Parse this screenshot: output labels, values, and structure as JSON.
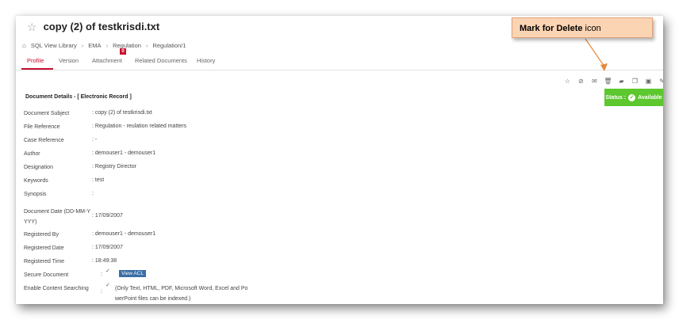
{
  "document": {
    "title": "copy (2) of testkrisdi.txt"
  },
  "breadcrumb": {
    "items": [
      "SQL View Library",
      "EMA",
      "Regulation",
      "Regulation/1"
    ]
  },
  "tabs": [
    {
      "label": "Profile",
      "active": true
    },
    {
      "label": "Version"
    },
    {
      "label": "Attachment",
      "badge": "0"
    },
    {
      "label": "Related Documents"
    },
    {
      "label": "History"
    }
  ],
  "toolbar": {
    "icons": [
      "star-icon",
      "link-icon",
      "mail-icon",
      "trash-icon",
      "folder-icon",
      "copy-icon",
      "lock-icon",
      "edit-icon"
    ]
  },
  "section": {
    "title": "Document Details - [ Electronic Record ]"
  },
  "status": {
    "label": "Status :",
    "value": "Available",
    "color": "#5cc72e"
  },
  "fields": [
    {
      "label": "Document Subject",
      "value": ": copy (2) of testkrisdi.txt"
    },
    {
      "label": "File Reference",
      "value": ": Regulation - reulation related matters"
    },
    {
      "label": "Case Reference",
      "value": ": -"
    },
    {
      "label": "Author",
      "value": ": demouser1 - demouser1"
    },
    {
      "label": "Designation",
      "value": ": Registry Director"
    },
    {
      "label": "Keywords",
      "value": ": test"
    },
    {
      "label": "Synopsis",
      "value": ":"
    },
    {
      "label_line1": "Document Date (DD-MM-Y",
      "label_line2": "YYY)",
      "value": ": 17/09/2007"
    },
    {
      "label": "Registered By",
      "value": ": demouser1 - demouser1"
    },
    {
      "label": "Registered Date",
      "value": ": 17/09/2007"
    },
    {
      "label": "Registered Time",
      "value": ": 18:49:38"
    },
    {
      "label": "Secure Document",
      "value": ":"
    },
    {
      "label": "Enable Content Searching",
      "value": ":"
    }
  ],
  "secure": {
    "view_acl": "View ACL"
  },
  "content_search": {
    "note_line1": "(Only Text, HTML, PDF, Microsoft Word, Excel and Po",
    "note_line2": "werPoint files can be indexed.)"
  },
  "callout": {
    "bold": "Mark for Delete",
    "rest": " icon",
    "bg": "#fbd4b4"
  }
}
